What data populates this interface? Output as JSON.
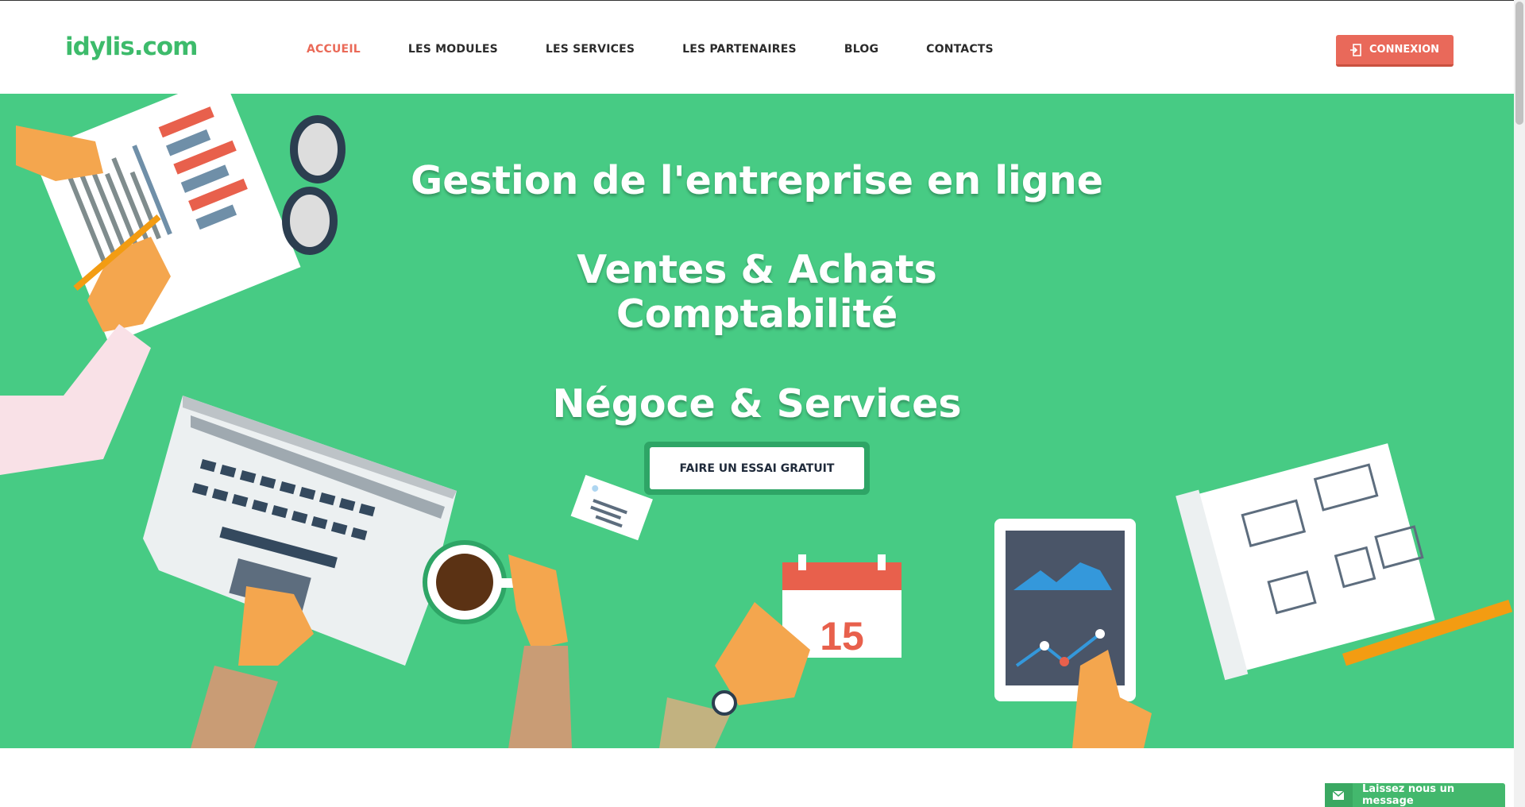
{
  "header": {
    "logo": "idylis.com",
    "nav": [
      {
        "label": "ACCUEIL",
        "active": true
      },
      {
        "label": "LES MODULES",
        "active": false
      },
      {
        "label": "LES SERVICES",
        "active": false
      },
      {
        "label": "LES PARTENAIRES",
        "active": false
      },
      {
        "label": "BLOG",
        "active": false
      },
      {
        "label": "CONTACTS",
        "active": false
      }
    ],
    "login_label": "CONNEXION"
  },
  "hero": {
    "line1": "Gestion de l'entreprise en ligne",
    "line2": "Ventes & Achats",
    "line3": "Comptabilité",
    "line4": "Négoce & Services",
    "cta_label": "FAIRE UN ESSAI GRATUIT",
    "calendar_day": "15"
  },
  "message_widget": {
    "label": "Laissez nous un message",
    "icon": "envelope-icon"
  },
  "colors": {
    "hero_bg": "#47cb84",
    "accent": "#e9695a",
    "brand": "#3dbb6b"
  }
}
